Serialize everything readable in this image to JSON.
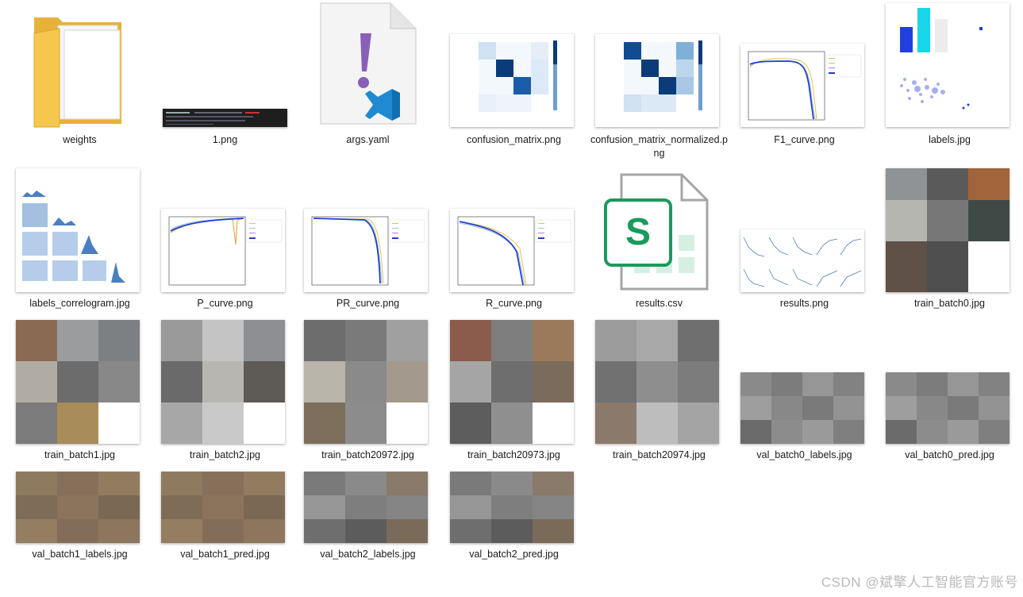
{
  "files": [
    {
      "name": "weights",
      "kind": "folder"
    },
    {
      "name": "1.png",
      "kind": "terminal"
    },
    {
      "name": "args.yaml",
      "kind": "yaml"
    },
    {
      "name": "confusion_matrix.png",
      "kind": "matrix"
    },
    {
      "name": "confusion_matrix_normalized.png",
      "kind": "matrix"
    },
    {
      "name": "F1_curve.png",
      "kind": "curve"
    },
    {
      "name": "labels.jpg",
      "kind": "labels"
    },
    {
      "name": "labels_correlogram.jpg",
      "kind": "correlogram"
    },
    {
      "name": "P_curve.png",
      "kind": "curve"
    },
    {
      "name": "PR_curve.png",
      "kind": "curve"
    },
    {
      "name": "R_curve.png",
      "kind": "curve"
    },
    {
      "name": "results.csv",
      "kind": "csv"
    },
    {
      "name": "results.png",
      "kind": "results"
    },
    {
      "name": "train_batch0.jpg",
      "kind": "photo"
    },
    {
      "name": "train_batch1.jpg",
      "kind": "photo"
    },
    {
      "name": "train_batch2.jpg",
      "kind": "photo"
    },
    {
      "name": "train_batch20972.jpg",
      "kind": "photo"
    },
    {
      "name": "train_batch20973.jpg",
      "kind": "photo"
    },
    {
      "name": "train_batch20974.jpg",
      "kind": "photo"
    },
    {
      "name": "val_batch0_labels.jpg",
      "kind": "photo"
    },
    {
      "name": "val_batch0_pred.jpg",
      "kind": "photo"
    },
    {
      "name": "val_batch1_labels.jpg",
      "kind": "photo"
    },
    {
      "name": "val_batch1_pred.jpg",
      "kind": "photo"
    },
    {
      "name": "val_batch2_labels.jpg",
      "kind": "photo"
    },
    {
      "name": "val_batch2_pred.jpg",
      "kind": "photo"
    }
  ],
  "watermark": "CSDN @斌擎人工智能官方账号",
  "colors": {
    "folder": "#f5c74f",
    "matrix_dark": "#0b3c7a",
    "curve_blue": "#1f3fe0",
    "csv_green": "#1a9a5c",
    "vscode_blue": "#1f8ad2",
    "yaml_purple": "#8a5fb8"
  }
}
